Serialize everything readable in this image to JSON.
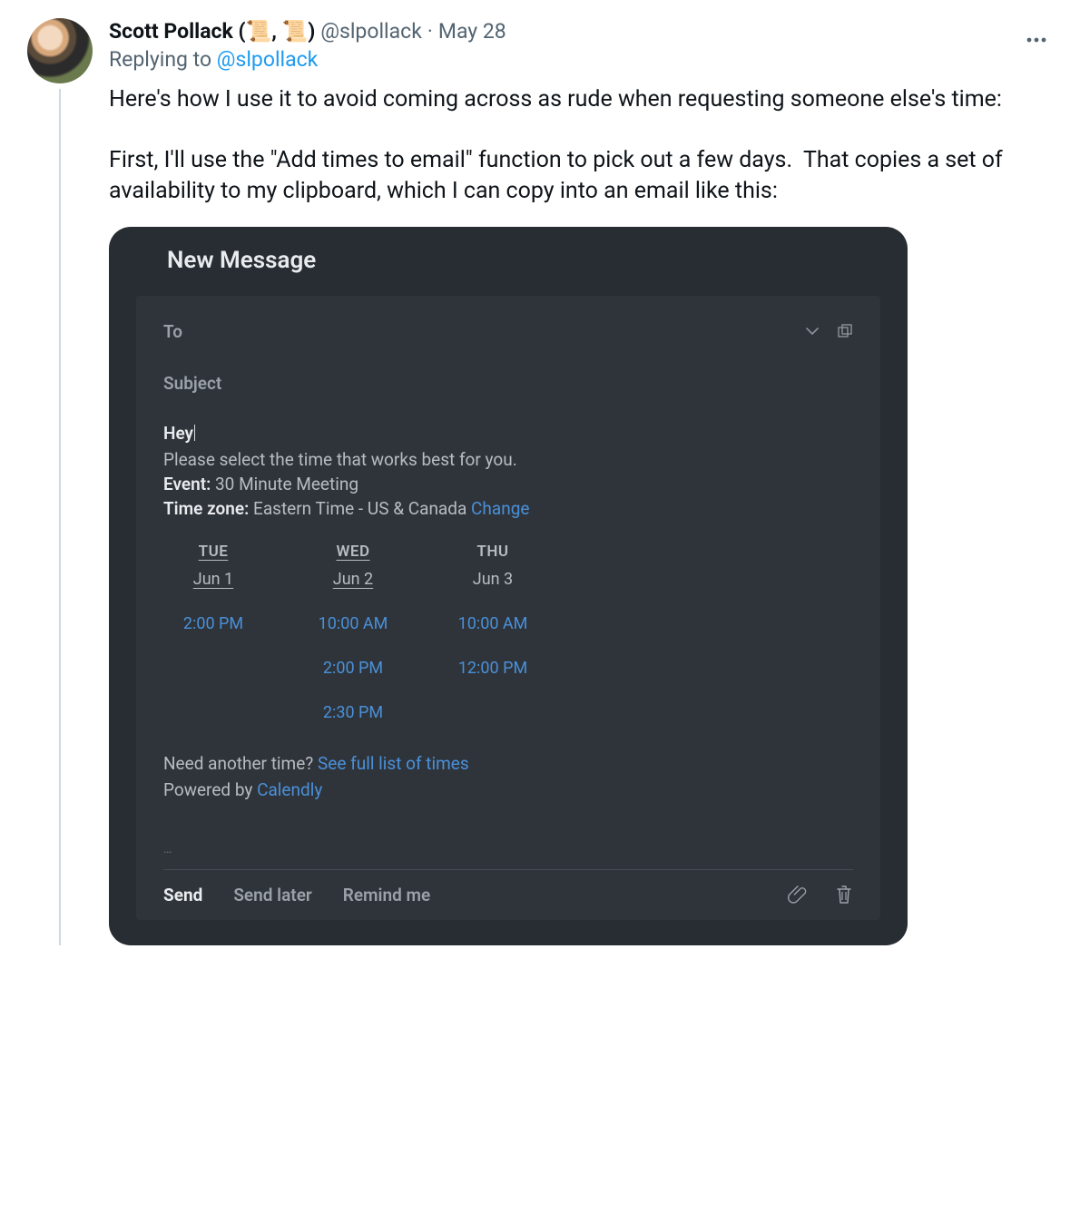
{
  "tweet": {
    "display_name": "Scott Pollack (📜, 📜)",
    "handle": "@slpollack",
    "dot": "·",
    "date": "May 28",
    "replying_prefix": "Replying to ",
    "replying_handle": "@slpollack",
    "body": "Here's how I use it to avoid coming across as rude when requesting someone else's time:\n\nFirst, I'll use the \"Add times to email\" function to pick out a few days.  That copies a set of availability to my clipboard, which I can copy into an email like this:"
  },
  "composer": {
    "title": "New Message",
    "to_label": "To",
    "subject_label": "Subject",
    "greeting": "Hey",
    "prompt": "Please select the time that works best for you.",
    "event_key": "Event:",
    "event_value": "30 Minute Meeting",
    "tz_key": "Time zone:",
    "tz_value": "Eastern Time - US & Canada",
    "tz_change": "Change",
    "days": [
      {
        "name": "TUE",
        "date": "Jun 1",
        "underlined": true,
        "slots": [
          "2:00 PM"
        ]
      },
      {
        "name": "WED",
        "date": "Jun 2",
        "underlined": true,
        "slots": [
          "10:00 AM",
          "2:00 PM",
          "2:30 PM"
        ]
      },
      {
        "name": "THU",
        "date": "Jun 3",
        "underlined": false,
        "slots": [
          "10:00 AM",
          "12:00 PM"
        ]
      }
    ],
    "need_prefix": "Need another time? ",
    "need_link": "See full list of times",
    "powered_prefix": "Powered by  ",
    "powered_link": "Calendly",
    "ellipsis": "…",
    "actions": {
      "send": "Send",
      "send_later": "Send later",
      "remind": "Remind me"
    }
  }
}
